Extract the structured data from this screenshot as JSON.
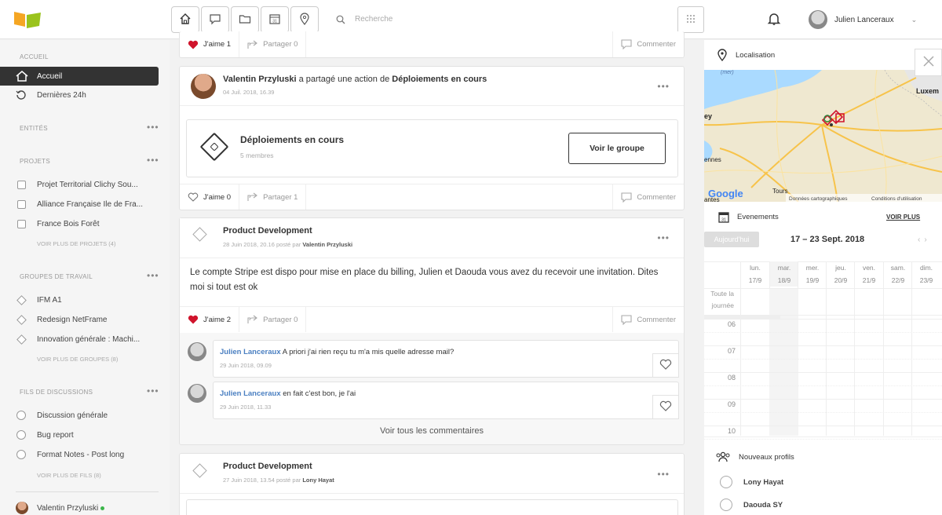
{
  "topbar": {
    "search_placeholder": "Recherche",
    "user_name": "Julien Lanceraux"
  },
  "sidebar": {
    "accueil_section": "ACCUEIL",
    "accueil_items": [
      {
        "label": "Accueil"
      },
      {
        "label": "Dernières 24h"
      }
    ],
    "entites_section": "ENTITÉS",
    "projets_section": "PROJETS",
    "projets": [
      {
        "label": "Projet Territorial Clichy Sou..."
      },
      {
        "label": "Alliance Française Ile de Fra..."
      },
      {
        "label": "France Bois Forêt"
      }
    ],
    "projets_more": "VOIR PLUS DE PROJETS (4)",
    "groupes_section": "GROUPES DE TRAVAIL",
    "groupes": [
      {
        "label": "IFM A1"
      },
      {
        "label": "Redesign NetFrame"
      },
      {
        "label": "Innovation générale : Machi..."
      }
    ],
    "groupes_more": "VOIR PLUS DE GROUPES (8)",
    "fils_section": "FILS DE DISCUSSIONS",
    "fils": [
      {
        "label": "Discussion générale"
      },
      {
        "label": "Bug report"
      },
      {
        "label": "Format Notes - Post long"
      }
    ],
    "fils_more": "VOIR PLUS DE FILS (8)",
    "footer_user": "Valentin Przyluski"
  },
  "feed": {
    "top_actions": {
      "like": "J'aime 1",
      "share": "Partager 0",
      "comment": "Commenter"
    },
    "post1": {
      "author": "Valentin Przyluski",
      "action": " a partagé une action de ",
      "group": "Déploiements en cours",
      "date": "04 Juil. 2018, 16.39",
      "card_title": "Déploiements en cours",
      "card_sub": "5 membres",
      "card_btn": "Voir le groupe",
      "like": "J'aime 0",
      "share": "Partager 1",
      "comment": "Commenter"
    },
    "post2": {
      "title": "Product Development",
      "date_prefix": "28 Juin 2018, 20.16 posté par ",
      "author": "Valentin Przyluski",
      "body": "Le compte Stripe est dispo pour mise en place du billing, Julien et Daouda vous avez du recevoir une invitation. Dites moi si tout est ok",
      "like": "J'aime 2",
      "share": "Partager 0",
      "comment": "Commenter",
      "comments": [
        {
          "author": "Julien Lanceraux",
          "text": " A priori j'ai rien reçu tu m'a mis quelle adresse mail?",
          "date": "29 Juin 2018, 09.09"
        },
        {
          "author": "Julien Lanceraux",
          "text": " en fait c'est bon, je l'ai",
          "date": "29 Juin 2018, 11.33"
        }
      ],
      "see_all": "Voir tous les commentaires"
    },
    "post3": {
      "title": "Product Development",
      "date_prefix": "27 Juin 2018, 13.54 posté par ",
      "author": "Lony Hayat"
    }
  },
  "right": {
    "loc_title": "Localisation",
    "map_labels": {
      "sea": "(mer)",
      "city_lux": "Luxem",
      "city_ey": "ey",
      "city_ennes": "ennes",
      "city_tours": "Tours",
      "city_nantes": "antes",
      "google": "Google",
      "data": "Données cartographiques",
      "terms": "Conditions d'utilisation"
    },
    "events_title": "Evenements",
    "see_more": "VOIR PLUS",
    "today": "Aujourd'hui",
    "range": "17 – 23 Sept. 2018",
    "days": [
      {
        "d": "lun.",
        "n": "17/9"
      },
      {
        "d": "mar.",
        "n": "18/9"
      },
      {
        "d": "mer.",
        "n": "19/9"
      },
      {
        "d": "jeu.",
        "n": "20/9"
      },
      {
        "d": "ven.",
        "n": "21/9"
      },
      {
        "d": "sam.",
        "n": "22/9"
      },
      {
        "d": "dim.",
        "n": "23/9"
      }
    ],
    "allday": "Toute la journée",
    "hours": [
      "06",
      "07",
      "08",
      "09",
      "10"
    ],
    "profiles_title": "Nouveaux profils",
    "profiles": [
      {
        "name": "Lony Hayat"
      },
      {
        "name": "Daouda SY"
      }
    ]
  },
  "colors": {
    "accent_red": "#d0142c",
    "link_blue": "#4a7fc1",
    "logo_orange": "#f5a623",
    "logo_green": "#9ac31c"
  }
}
